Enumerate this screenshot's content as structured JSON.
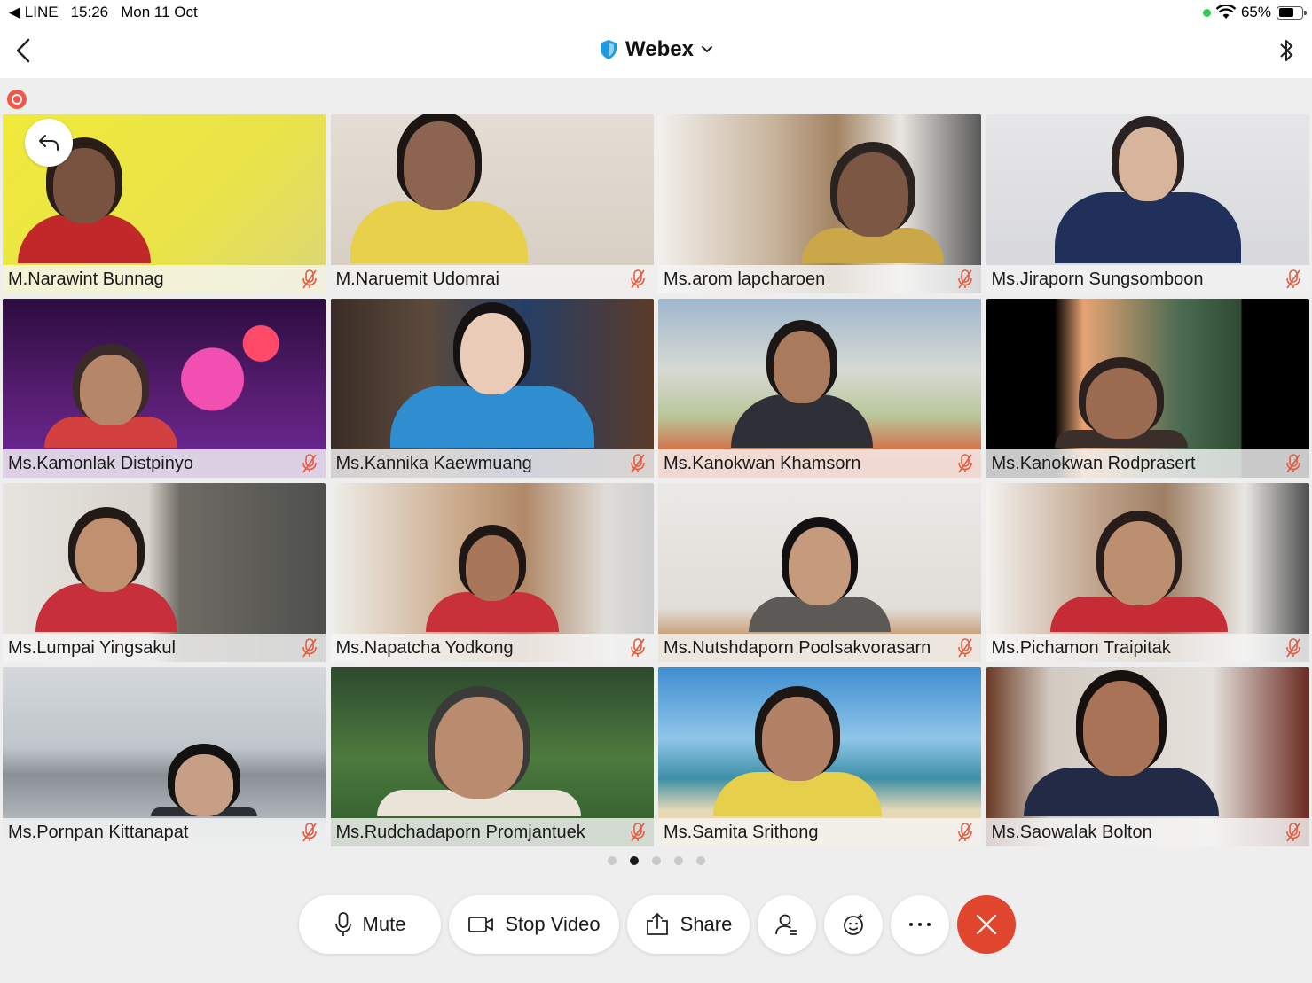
{
  "status_bar": {
    "back_app": "◀ LINE",
    "time": "15:26",
    "date": "Mon 11 Oct",
    "battery": "65%",
    "battery_level": 0.65
  },
  "header": {
    "title": "Webex"
  },
  "participants": [
    {
      "name": "M.Narawint Bunnag",
      "muted": true
    },
    {
      "name": "M.Naruemit Udomrai",
      "muted": true
    },
    {
      "name": "Ms.arom lapcharoen",
      "muted": true
    },
    {
      "name": "Ms.Jiraporn Sungsomboon",
      "muted": true
    },
    {
      "name": "Ms.Kamonlak Distpinyo",
      "muted": true
    },
    {
      "name": "Ms.Kannika Kaewmuang",
      "muted": true
    },
    {
      "name": "Ms.Kanokwan Khamsorn",
      "muted": true
    },
    {
      "name": "Ms.Kanokwan Rodprasert",
      "muted": true
    },
    {
      "name": "Ms.Lumpai Yingsakul",
      "muted": true
    },
    {
      "name": "Ms.Napatcha Yodkong",
      "muted": true
    },
    {
      "name": "Ms.Nutshdaporn Poolsakvorasarn",
      "muted": true
    },
    {
      "name": "Ms.Pichamon Traipitak",
      "muted": true
    },
    {
      "name": "Ms.Pornpan Kittanapat",
      "muted": true
    },
    {
      "name": "Ms.Rudchadaporn Promjantuek",
      "muted": true
    },
    {
      "name": "Ms.Samita Srithong",
      "muted": true
    },
    {
      "name": "Ms.Saowalak Bolton",
      "muted": true
    }
  ],
  "pager": {
    "pages": 5,
    "current": 2
  },
  "toolbar": {
    "mute_label": "Mute",
    "stop_video_label": "Stop Video",
    "share_label": "Share"
  },
  "colors": {
    "end_call": "#e0462e",
    "recording": "#f2584a",
    "mic_off": "#e8593f",
    "webex_shield": "#1f9ce0"
  }
}
